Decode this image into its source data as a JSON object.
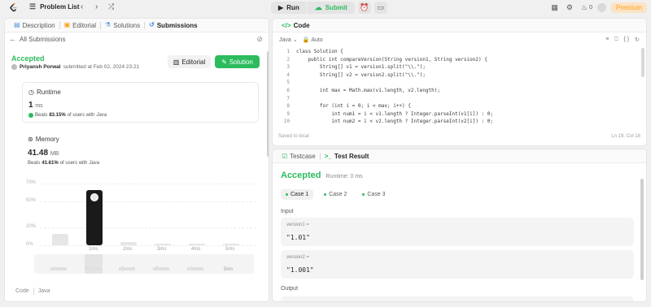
{
  "topbar": {
    "problem_list": "Problem List",
    "run": "Run",
    "submit": "Submit",
    "streak": "0",
    "premium": "Premium"
  },
  "left_tabs": [
    "Description",
    "Editorial",
    "Solutions",
    "Submissions"
  ],
  "left": {
    "back": "All Submissions",
    "status": "Accepted",
    "author": "Priyansh Porwal",
    "submitted": "submitted at Feb 02, 2024 23:21",
    "editorial_btn": "Editorial",
    "solution_btn": "Solution",
    "runtime": {
      "title": "Runtime",
      "value": "1",
      "unit": "ms",
      "beats_prefix": "Beats",
      "beats_pct": "83.15%",
      "beats_mid": "of users with",
      "lang": "Java"
    },
    "memory": {
      "title": "Memory",
      "value": "41.48",
      "unit": "MB",
      "beats_prefix": "Beats",
      "beats_pct": "41.61%",
      "beats_mid": "of users with",
      "lang": "Java"
    },
    "code_label": "Code",
    "code_lang": "Java"
  },
  "chart_data": {
    "type": "bar",
    "ytick_labels": [
      "70%",
      "50%",
      "20%",
      "0%"
    ],
    "categories": [
      "",
      "1ms",
      "2ms",
      "3ms",
      "4ms",
      "5ms"
    ],
    "values": [
      13,
      63,
      4,
      2,
      2,
      2
    ],
    "highlight_index": 1,
    "ylim": [
      0,
      75
    ],
    "slider_labels": [
      "1ms",
      "2ms",
      "3ms",
      "4ms",
      "5ms"
    ]
  },
  "editor": {
    "title": "Code",
    "lang": "Java",
    "mode": "Auto",
    "saved": "Saved to local",
    "cursor": "Ln 19, Col 18",
    "lines": [
      {
        "n": "1",
        "t": "class Solution {"
      },
      {
        "n": "2",
        "t": "    public int compareVersion(String version1, String version2) {"
      },
      {
        "n": "3",
        "t": "        String[] v1 = version1.split(\"\\\\.\");"
      },
      {
        "n": "4",
        "t": "        String[] v2 = version2.split(\"\\\\.\");"
      },
      {
        "n": "5",
        "t": ""
      },
      {
        "n": "6",
        "t": "        int max = Math.max(v1.length, v2.length);"
      },
      {
        "n": "7",
        "t": ""
      },
      {
        "n": "8",
        "t": "        for (int i = 0; i < max; i++) {"
      },
      {
        "n": "9",
        "t": "            int num1 = i < v1.length ? Integer.parseInt(v1[i]) : 0;"
      },
      {
        "n": "10",
        "t": "            int num2 = i < v2.length ? Integer.parseInt(v2[i]) : 0;"
      }
    ]
  },
  "result": {
    "tab_testcase": "Testcase",
    "tab_result": "Test Result",
    "status": "Accepted",
    "runtime": "Runtime: 0 ms",
    "cases": [
      "Case 1",
      "Case 2",
      "Case 3"
    ],
    "input_label": "Input",
    "inputs": [
      {
        "key": "version1 =",
        "value": "\"1.01\""
      },
      {
        "key": "version2 =",
        "value": "\"1.001\""
      }
    ],
    "output_label": "Output"
  }
}
